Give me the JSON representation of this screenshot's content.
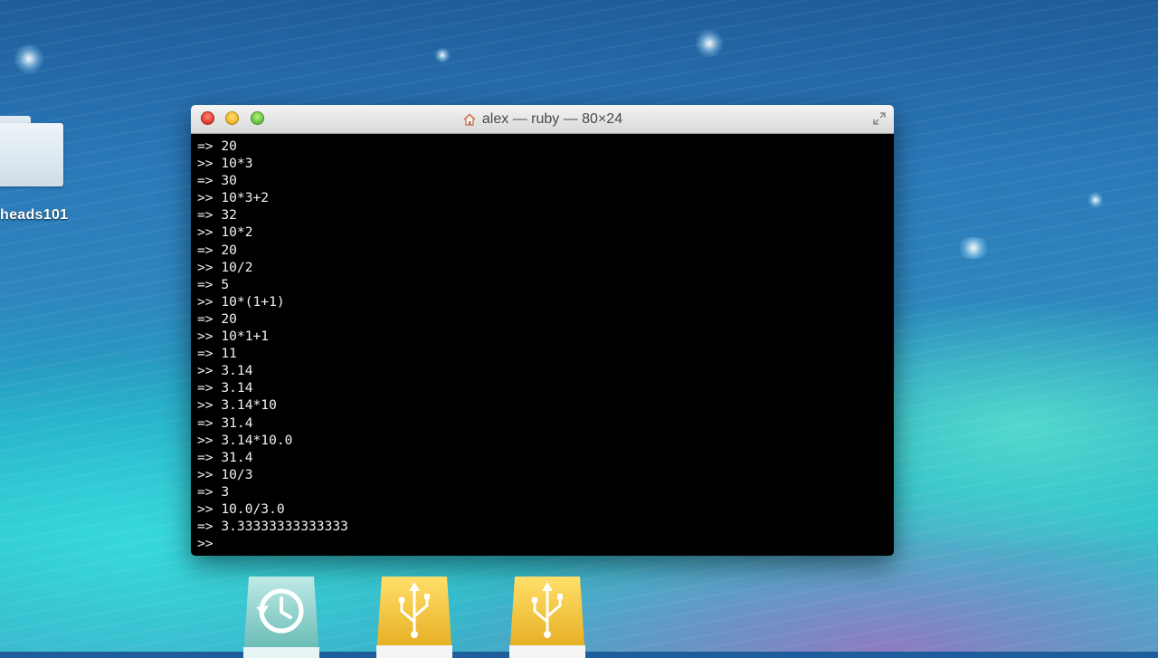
{
  "desktop": {
    "folder_label": "heads101"
  },
  "window": {
    "title": "alex — ruby — 80×24",
    "lines": [
      "=> 20",
      ">> 10*3",
      "=> 30",
      ">> 10*3+2",
      "=> 32",
      ">> 10*2",
      "=> 20",
      ">> 10/2",
      "=> 5",
      ">> 10*(1+1)",
      "=> 20",
      ">> 10*1+1",
      "=> 11",
      ">> 3.14",
      "=> 3.14",
      ">> 3.14*10",
      "=> 31.4",
      ">> 3.14*10.0",
      "=> 31.4",
      ">> 10/3",
      "=> 3",
      ">> 10.0/3.0",
      "=> 3.33333333333333",
      ">> "
    ]
  },
  "dock": {
    "items": [
      "time-machine-icon",
      "usb-drive-icon",
      "usb-drive-icon"
    ]
  },
  "colors": {
    "terminal_bg": "#000000",
    "terminal_fg": "#f2f2f2",
    "usb_drive": "#f2c230",
    "time_machine": "#8fd3cf"
  }
}
